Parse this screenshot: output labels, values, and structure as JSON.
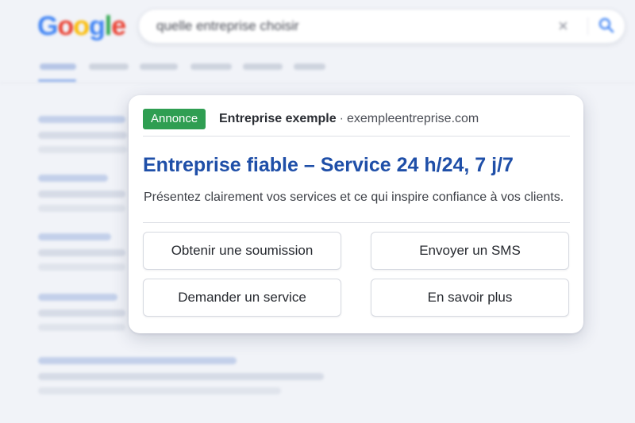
{
  "logo": {
    "letters": [
      "G",
      "o",
      "o",
      "g",
      "l",
      "e"
    ],
    "colors": [
      "#4285f4",
      "#ea4335",
      "#fbbc05",
      "#4285f4",
      "#34a853",
      "#ea4335"
    ]
  },
  "search": {
    "query": "quelle entreprise choisir",
    "clear_icon": "close-icon",
    "search_icon": "search-icon",
    "accent": "#4285f4"
  },
  "ad": {
    "badge": "Annonce",
    "badge_color": "#2f9e52",
    "advertiser": "Entreprise exemple",
    "separator": "·",
    "domain": "exempleentreprise.com",
    "title": "Entreprise fiable – Service 24 h/24, 7 j/7",
    "title_color": "#1f4fa8",
    "description": "Présentez clairement vos services et ce qui inspire confiance à vos clients.",
    "actions": [
      "Obtenir une soumission",
      "Envoyer un SMS",
      "Demander un service",
      "En savoir plus"
    ]
  }
}
